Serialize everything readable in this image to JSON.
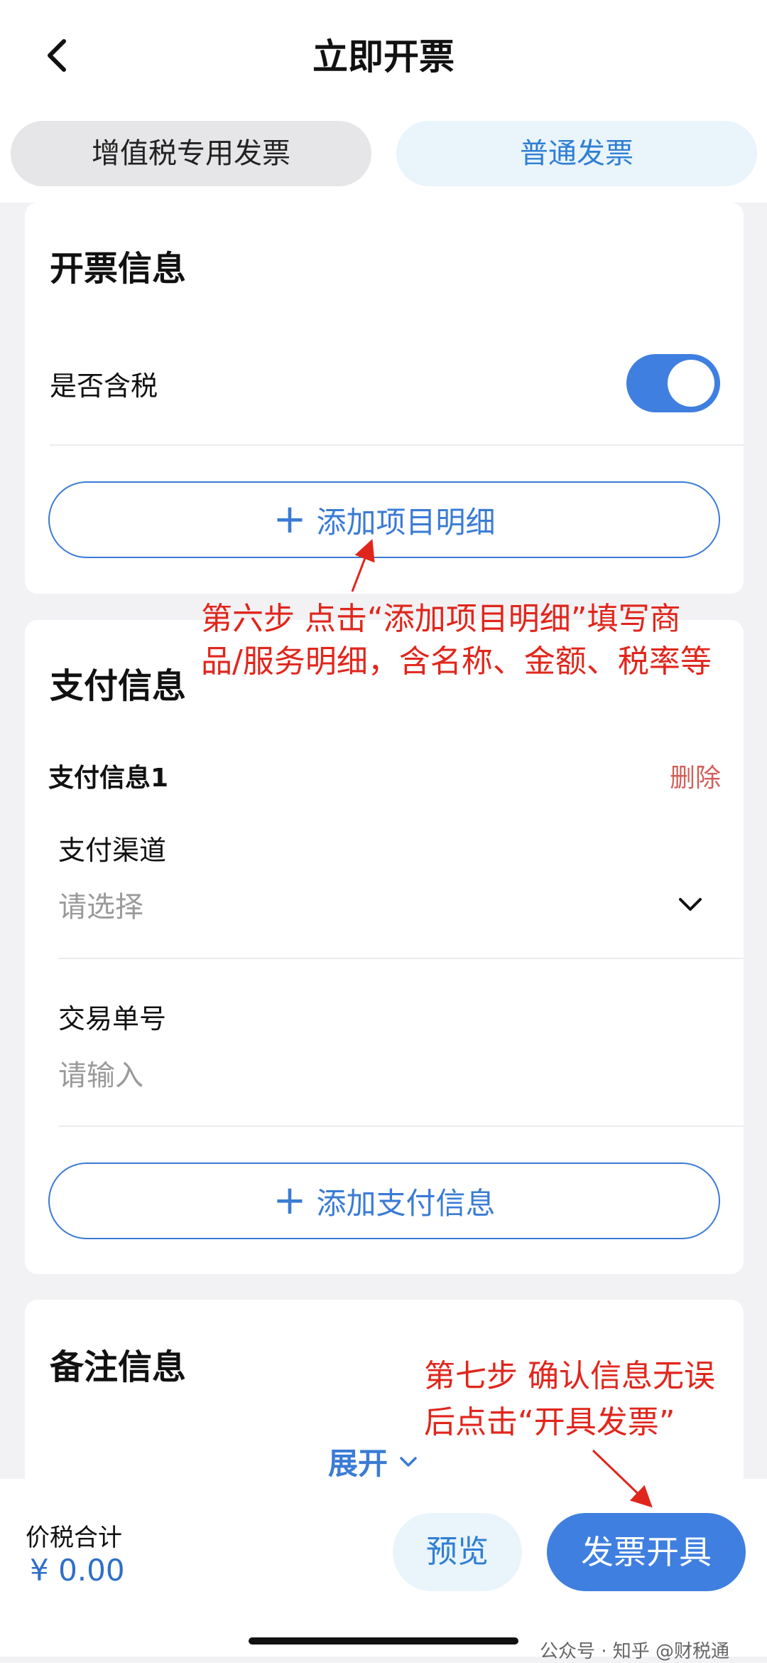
{
  "header": {
    "title": "立即开票",
    "tabs": [
      {
        "label": "增值税专用发票"
      },
      {
        "label": "普通发票"
      }
    ]
  },
  "invoice_info": {
    "title": "开票信息",
    "tax_included_label": "是否含税",
    "tax_included": true,
    "add_item_label": "添加项目明细"
  },
  "payment_info": {
    "title": "支付信息",
    "entry_title": "支付信息1",
    "delete_label": "删除",
    "channel_label": "支付渠道",
    "channel_placeholder": "请选择",
    "txn_label": "交易单号",
    "txn_placeholder": "请输入",
    "add_payment_label": "添加支付信息"
  },
  "remarks": {
    "title": "备注信息",
    "expand_label": "展开"
  },
  "footer": {
    "total_label": "价税合计",
    "total_value": "¥ 0.00",
    "preview_label": "预览",
    "issue_label": "发票开具"
  },
  "annotations": {
    "step6_line1": "第六步 点击“添加项目明细”填写商",
    "step6_line2": "品/服务明细，含名称、金额、税率等",
    "step7_line1": "第七步 确认信息无误",
    "step7_line2": "后点击“开具发票”"
  },
  "watermark": "公众号 · 知乎 @财税通",
  "colors": {
    "accent": "#3f7fe0",
    "annotation": "#e0261c",
    "delete": "#d0605a"
  }
}
